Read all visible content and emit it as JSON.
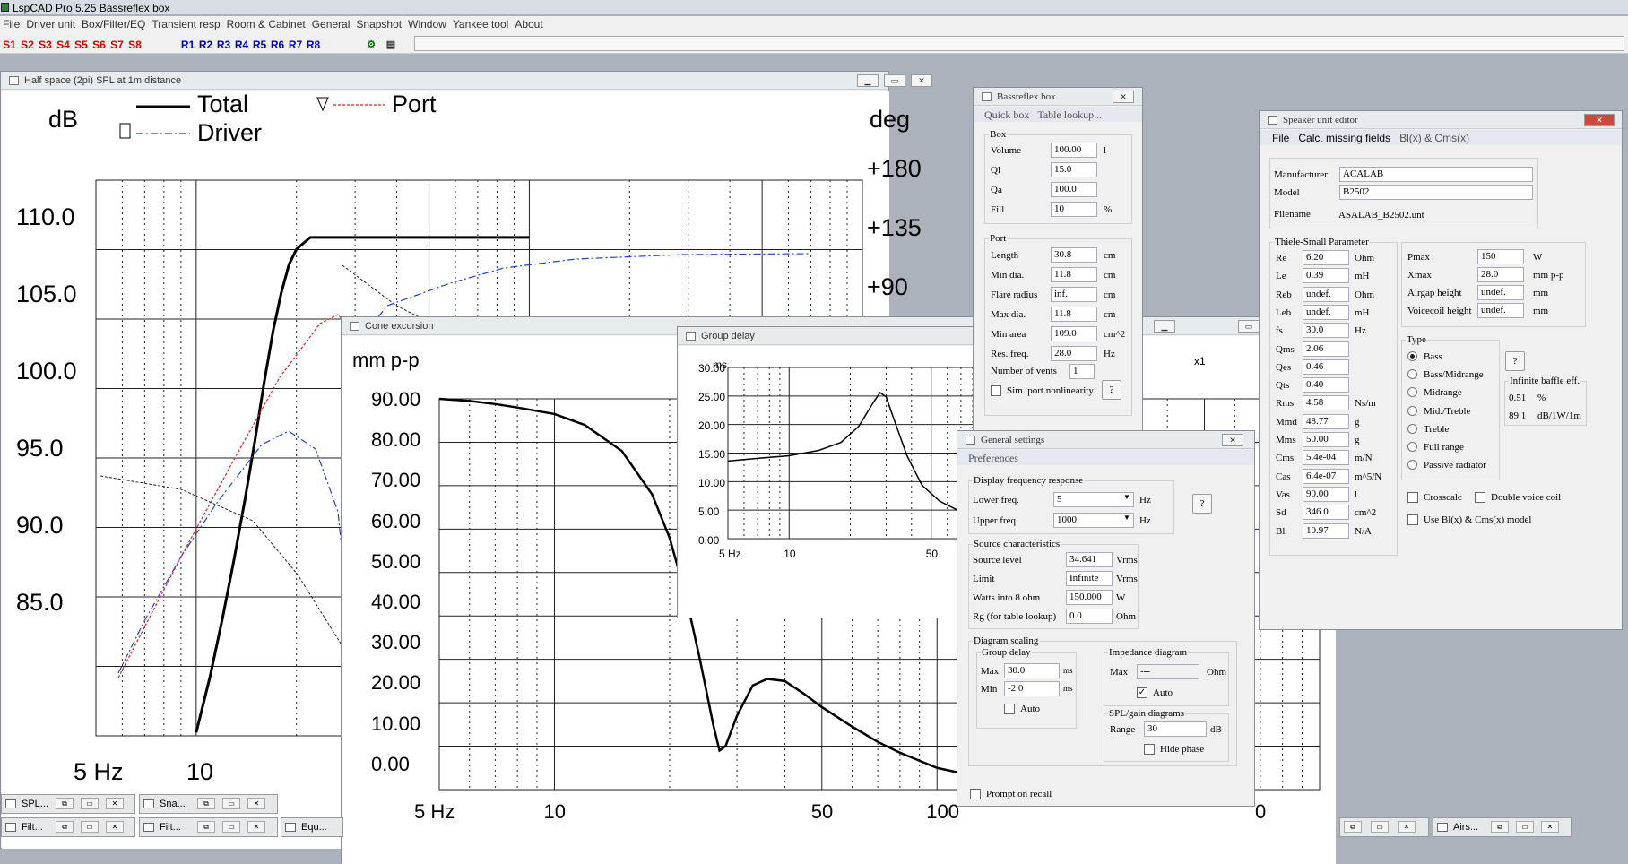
{
  "app": {
    "title": "LspCAD Pro 5.25 Bassreflex box"
  },
  "menu": [
    "File",
    "Driver unit",
    "Box/Filter/EQ",
    "Transient resp",
    "Room & Cabinet",
    "General",
    "Snapshot",
    "Window",
    "Yankee tool",
    "About"
  ],
  "toolbar": {
    "s": [
      "S1",
      "S2",
      "S3",
      "S4",
      "S5",
      "S6",
      "S7",
      "S8"
    ],
    "r": [
      "R1",
      "R2",
      "R3",
      "R4",
      "R5",
      "R6",
      "R7",
      "R8"
    ]
  },
  "spl": {
    "title": "Half space (2pi) SPL at 1m distance",
    "ylabel": "dB",
    "y2label": "deg",
    "legend": {
      "total": "Total",
      "driver": "Driver",
      "port": "Port"
    },
    "yticks": [
      "110.0",
      "105.0",
      "100.0",
      "95.0",
      "90.0",
      "85.0"
    ],
    "y2ticks": [
      "+180",
      "+135",
      "+90"
    ],
    "xticks": [
      "5 Hz",
      "10"
    ]
  },
  "cone": {
    "title": "Cone excursion",
    "ylabel": "mm p-p",
    "yticks": [
      "90.00",
      "80.00",
      "70.00",
      "60.00",
      "50.00",
      "40.00",
      "30.00",
      "20.00",
      "10.00",
      "0.00"
    ],
    "xticks": [
      "5 Hz",
      "10",
      "50",
      "100"
    ],
    "xtail": "0"
  },
  "gd": {
    "title": "Group delay",
    "ylabel": "ms",
    "yticks": [
      "30.00",
      "25.00",
      "20.00",
      "15.00",
      "10.00",
      "5.00",
      "0.00"
    ],
    "xticks": [
      "5 Hz",
      "10",
      "50"
    ]
  },
  "hidden": {
    "x1": "x1"
  },
  "br": {
    "title": "Bassreflex box",
    "menu": [
      "Quick box",
      "Table lookup..."
    ],
    "box_title": "Box",
    "box": [
      {
        "label": "Volume",
        "value": "100.00",
        "unit": "l"
      },
      {
        "label": "Ql",
        "value": "15.0",
        "unit": ""
      },
      {
        "label": "Qa",
        "value": "100.0",
        "unit": ""
      },
      {
        "label": "Fill",
        "value": "10",
        "unit": "%"
      }
    ],
    "port_title": "Port",
    "port": [
      {
        "label": "Length",
        "value": "30.8",
        "unit": "cm"
      },
      {
        "label": "Min dia.",
        "value": "11.8",
        "unit": "cm"
      },
      {
        "label": "Flare radius",
        "value": "inf.",
        "unit": "cm"
      },
      {
        "label": "Max dia.",
        "value": "11.8",
        "unit": "cm"
      },
      {
        "label": "Min area",
        "value": "109.0",
        "unit": "cm^2"
      },
      {
        "label": "Res. freq.",
        "value": "28.0",
        "unit": "Hz"
      }
    ],
    "vents_label": "Number of vents",
    "vents": "1",
    "sim_label": "Sim. port nonlinearity",
    "help": "?"
  },
  "gs": {
    "title": "General settings",
    "menu": "Preferences",
    "disp_title": "Display frequency response",
    "lower_label": "Lower freq.",
    "lower": "5",
    "upper_label": "Upper freq.",
    "upper": "1000",
    "hz": "Hz",
    "help": "?",
    "src_title": "Source characteristics",
    "src": [
      {
        "label": "Source level",
        "value": "34.641",
        "unit": "Vrms"
      },
      {
        "label": "Limit",
        "value": "Infinite",
        "unit": "Vrms"
      },
      {
        "label": "Watts into 8 ohm",
        "value": "150.000",
        "unit": "W"
      },
      {
        "label": "Rg (for table lookup)",
        "value": "0.0",
        "unit": "Ohm"
      }
    ],
    "diag_title": "Diagram scaling",
    "gd_title": "Group delay",
    "max_label": "Max",
    "max": "30.0",
    "min_label": "Min",
    "min": "-2.0",
    "ms": "ms",
    "auto": "Auto",
    "imp_title": "Impedance diagram",
    "imp_max": "---",
    "ohm": "Ohm",
    "spl_title": "SPL/gain diagrams",
    "range_label": "Range",
    "range": "30",
    "db": "dB",
    "hide_phase": "Hide phase",
    "prompt": "Prompt on recall"
  },
  "spk": {
    "title": "Speaker unit editor",
    "menu": [
      "File",
      "Calc. missing fields",
      "Bl(x) & Cms(x)"
    ],
    "manufacturer_label": "Manufacturer",
    "manufacturer": "ACALAB",
    "model_label": "Model",
    "model": "B2502",
    "filename_label": "Filename",
    "filename": "ASALAB_B2502.unt",
    "ts_title": "Thiele-Small Parameter",
    "ts": [
      {
        "label": "Re",
        "value": "6.20",
        "unit": "Ohm"
      },
      {
        "label": "Le",
        "value": "0.39",
        "unit": "mH"
      },
      {
        "label": "Reb",
        "value": "undef.",
        "unit": "Ohm"
      },
      {
        "label": "Leb",
        "value": "undef.",
        "unit": "mH"
      },
      {
        "label": "fs",
        "value": "30.0",
        "unit": "Hz"
      },
      {
        "label": "Qms",
        "value": "2.06",
        "unit": ""
      },
      {
        "label": "Qes",
        "value": "0.46",
        "unit": ""
      },
      {
        "label": "Qts",
        "value": "0.40",
        "unit": ""
      },
      {
        "label": "Rms",
        "value": "4.58",
        "unit": "Ns/m"
      },
      {
        "label": "Mmd",
        "value": "48.77",
        "unit": "g"
      },
      {
        "label": "Mms",
        "value": "50.00",
        "unit": "g"
      },
      {
        "label": "Cms",
        "value": "5.4e-04",
        "unit": "m/N"
      },
      {
        "label": "Cas",
        "value": "6.4e-07",
        "unit": "m^5/N"
      },
      {
        "label": "Vas",
        "value": "90.00",
        "unit": "l"
      },
      {
        "label": "Sd",
        "value": "346.0",
        "unit": "cm^2"
      },
      {
        "label": "Bl",
        "value": "10.97",
        "unit": "N/A"
      }
    ],
    "right": [
      {
        "label": "Pmax",
        "value": "150",
        "unit": "W"
      },
      {
        "label": "Xmax",
        "value": "28.0",
        "unit": "mm p-p"
      },
      {
        "label": "Airgap height",
        "value": "undef.",
        "unit": "mm"
      },
      {
        "label": "Voicecoil height",
        "value": "undef.",
        "unit": "mm"
      }
    ],
    "type_title": "Type",
    "types": [
      "Bass",
      "Bass/Midrange",
      "Midrange",
      "Mid./Treble",
      "Treble",
      "Full range",
      "Passive radiator"
    ],
    "help": "?",
    "ib_title": "Infinite baffle eff.",
    "ib1": "0.51",
    "ib1u": "%",
    "ib2": "89.1",
    "ib2u": "dB/1W/1m",
    "crosscalc": "Crosscalc",
    "dvc": "Double voice coil",
    "blx": "Use Bl(x) & Cms(x) model"
  },
  "tasks": [
    "SPL...",
    "Sna...",
    "Filt...",
    "Filt...",
    "Equ...",
    "Airs..."
  ],
  "chart_data": [
    {
      "type": "line",
      "title": "Half space (2pi) SPL at 1m distance",
      "ylabel": "dB",
      "ylim": [
        82,
        115
      ],
      "y2label": "deg",
      "x_scale": "log",
      "series": [
        {
          "name": "Total",
          "x": [
            10,
            11,
            12,
            13,
            14,
            15,
            16,
            17,
            18,
            19,
            20,
            22,
            25,
            30,
            40,
            60,
            100
          ],
          "y": [
            82.2,
            85.5,
            89,
            92.5,
            96,
            99.5,
            103,
            106,
            108.3,
            110,
            110.9,
            111.6,
            111.6,
            111.6,
            111.6,
            111.6,
            111.6
          ]
        },
        {
          "name": "Driver"
        },
        {
          "name": "Port"
        }
      ]
    },
    {
      "type": "line",
      "title": "Cone excursion",
      "ylabel": "mm p-p",
      "ylim": [
        0,
        90
      ],
      "x_scale": "log",
      "series": [
        {
          "x": [
            5,
            6,
            7,
            8,
            10,
            12,
            15,
            18,
            20,
            22,
            24,
            26,
            27,
            28,
            30,
            33,
            36,
            40,
            45,
            50,
            60,
            70,
            80,
            100,
            120
          ],
          "y": [
            90,
            89.5,
            88.8,
            88,
            86.5,
            84,
            78,
            68,
            58,
            45,
            30,
            15,
            9,
            10,
            17,
            24,
            25.5,
            25,
            22,
            19,
            14.5,
            11,
            8.5,
            5,
            3.5
          ]
        }
      ]
    },
    {
      "type": "line",
      "title": "Group delay",
      "ylabel": "ms",
      "ylim": [
        -2,
        30
      ],
      "x_scale": "log",
      "series": [
        {
          "x": [
            5,
            7,
            10,
            14,
            18,
            22,
            26,
            28,
            30,
            33,
            38,
            45,
            55,
            70
          ],
          "y": [
            12.5,
            13,
            13.5,
            14.5,
            16,
            19,
            23.5,
            25.3,
            24.5,
            20,
            13.5,
            8,
            5,
            3
          ]
        }
      ]
    }
  ]
}
